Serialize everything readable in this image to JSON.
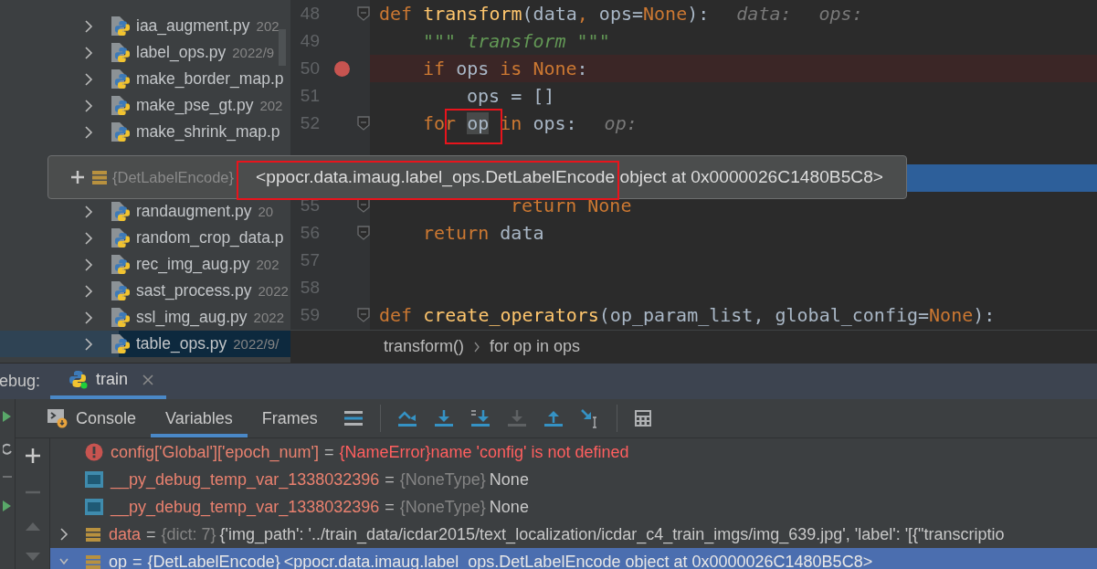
{
  "project_tree": {
    "items": [
      {
        "name": "iaa_augment.py",
        "date": "202",
        "expanded": false,
        "selected": false
      },
      {
        "name": "label_ops.py",
        "date": "2022/9",
        "expanded": false,
        "selected": false
      },
      {
        "name": "make_border_map.p",
        "expanded": false,
        "selected": false
      },
      {
        "name": "make_pse_gt.py",
        "date": "202",
        "expanded": false,
        "selected": false
      },
      {
        "name": "make_shrink_map.p",
        "expanded": false,
        "selected": false
      }
    ],
    "items_below": [
      {
        "name": "randaugment.py",
        "date": "20",
        "expanded": false,
        "selected": false
      },
      {
        "name": "random_crop_data.p",
        "expanded": false,
        "selected": false
      },
      {
        "name": "rec_img_aug.py",
        "date": "202",
        "expanded": false,
        "selected": false
      },
      {
        "name": "sast_process.py",
        "date": "2022",
        "expanded": false,
        "selected": false
      },
      {
        "name": "ssl_img_aug.py",
        "date": "2022",
        "expanded": false,
        "selected": false
      },
      {
        "name": "table_ops.py",
        "date": "2022/9/",
        "expanded": false,
        "selected": true
      }
    ]
  },
  "editor": {
    "lines": [
      {
        "number": "48",
        "breakpoint": false,
        "current": false,
        "fold": true,
        "tokens": [
          {
            "kind": "kw",
            "text": "def "
          },
          {
            "kind": "fn",
            "text": "transform"
          },
          {
            "kind": "plain",
            "text": "(data"
          },
          {
            "kind": "kw",
            "text": ", "
          },
          {
            "kind": "plain",
            "text": "ops="
          },
          {
            "kind": "kw",
            "text": "None"
          },
          {
            "kind": "plain",
            "text": "):"
          },
          {
            "kind": "hint",
            "text": "data:"
          },
          {
            "kind": "hint",
            "text": "ops:"
          }
        ]
      },
      {
        "number": "49",
        "breakpoint": false,
        "current": false,
        "fold": false,
        "tokens": [
          {
            "kind": "indent1"
          },
          {
            "kind": "doc",
            "text": "\"\"\" transform \"\"\""
          }
        ]
      },
      {
        "number": "50",
        "breakpoint": true,
        "current": false,
        "fold": false,
        "tokens": [
          {
            "kind": "indent1"
          },
          {
            "kind": "kw",
            "text": "if "
          },
          {
            "kind": "plain",
            "text": "ops "
          },
          {
            "kind": "kw",
            "text": "is None"
          },
          {
            "kind": "plain",
            "text": ":"
          }
        ]
      },
      {
        "number": "51",
        "breakpoint": false,
        "current": false,
        "fold": false,
        "tokens": [
          {
            "kind": "indent2"
          },
          {
            "kind": "plain",
            "text": "ops = []"
          }
        ]
      },
      {
        "number": "52",
        "breakpoint": false,
        "current": false,
        "fold": true,
        "tokens": [
          {
            "kind": "indent1"
          },
          {
            "kind": "kw",
            "text": "for "
          },
          {
            "kind": "ref",
            "text": "op"
          },
          {
            "kind": "kw",
            "text": " in "
          },
          {
            "kind": "plain",
            "text": "ops:"
          },
          {
            "kind": "hint",
            "text": "op:"
          }
        ]
      },
      {
        "current": false
      },
      {
        "current": true
      },
      {
        "number": "55",
        "breakpoint": false,
        "current": false,
        "fold": true,
        "tokens": [
          {
            "kind": "indent3"
          },
          {
            "kind": "kw",
            "text": "return None"
          }
        ]
      },
      {
        "number": "56",
        "breakpoint": false,
        "current": false,
        "fold": true,
        "tokens": [
          {
            "kind": "indent1"
          },
          {
            "kind": "kw",
            "text": "return "
          },
          {
            "kind": "plain",
            "text": "data"
          }
        ]
      },
      {
        "number": "57",
        "breakpoint": false,
        "current": false,
        "fold": false
      },
      {
        "number": "58",
        "breakpoint": false,
        "current": false,
        "fold": false
      },
      {
        "number": "59",
        "breakpoint": false,
        "current": false,
        "fold": true,
        "tokens": [
          {
            "kind": "kw",
            "text": "def "
          },
          {
            "kind": "fn",
            "text": "create_operators"
          },
          {
            "kind": "plain",
            "text": "(op_param_list, global_config="
          },
          {
            "kind": "kw",
            "text": "None"
          },
          {
            "kind": "plain",
            "text": "):"
          }
        ]
      }
    ],
    "breadcrumb": [
      "transform()",
      "for op in ops"
    ]
  },
  "value_tooltip": {
    "type": "{DetLabelEncode}",
    "value": "<ppocr.data.imaug.label_ops.DetLabelEncode object at 0x0000026C1480B5C8>"
  },
  "debug": {
    "label": "ebug:",
    "tabs": [
      {
        "label": "train",
        "selected": true
      }
    ],
    "view_tabs": [
      {
        "label": "Console",
        "selected": false
      },
      {
        "label": "Variables",
        "selected": true
      },
      {
        "label": "Frames",
        "selected": false
      }
    ],
    "variables": [
      {
        "kind": "error",
        "name": "config['Global']['epoch_num']",
        "equals": "=",
        "type": "{NameError}",
        "value": "name 'config' is not defined",
        "selected": false
      },
      {
        "kind": "scalar",
        "name": "__py_debug_temp_var_1338032396",
        "equals": "=",
        "type": "{NoneType}",
        "value": "None",
        "selected": false
      },
      {
        "kind": "scalar",
        "name": "__py_debug_temp_var_1338032396",
        "equals": "=",
        "type": "{NoneType}",
        "value": "None",
        "selected": false
      },
      {
        "kind": "object",
        "name": "data",
        "equals": "=",
        "type": "{dict: 7}",
        "value": "{'img_path': '../train_data/icdar2015/text_localization/icdar_c4_train_imgs/img_639.jpg', 'label': '[{\"transcriptio",
        "expanded": false,
        "selected": false
      },
      {
        "kind": "object",
        "name": "op",
        "equals": "=",
        "type": "{DetLabelEncode}",
        "value": "<ppocr.data.imaug.label_ops.DetLabelEncode object at 0x0000026C1480B5C8>",
        "expanded": true,
        "selected": true
      }
    ]
  }
}
